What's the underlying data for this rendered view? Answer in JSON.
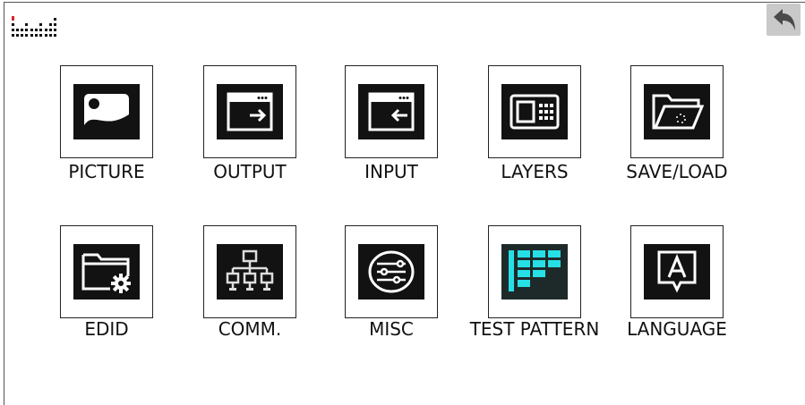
{
  "header": {
    "logo_icon": "dot-matrix-logo",
    "back_icon": "back-arrow-icon"
  },
  "menu": {
    "row1": [
      {
        "label": "PICTURE",
        "icon": "picture-icon"
      },
      {
        "label": "OUTPUT",
        "icon": "output-icon"
      },
      {
        "label": "INPUT",
        "icon": "input-icon"
      },
      {
        "label": "LAYERS",
        "icon": "layers-icon"
      },
      {
        "label": "SAVE/LOAD",
        "icon": "folder-open-icon"
      }
    ],
    "row2": [
      {
        "label": "EDID",
        "icon": "folder-gear-icon"
      },
      {
        "label": "COMM.",
        "icon": "network-icon"
      },
      {
        "label": "MISC",
        "icon": "sliders-icon"
      },
      {
        "label": "TEST PATTERN",
        "icon": "test-pattern-icon"
      },
      {
        "label": "LANGUAGE",
        "icon": "language-icon"
      }
    ]
  },
  "colors": {
    "accent_red": "#d8262a",
    "icon_bg": "#121212",
    "test_pattern_cyan": "#26e0e6",
    "back_button_bg": "#c9c9c9"
  }
}
